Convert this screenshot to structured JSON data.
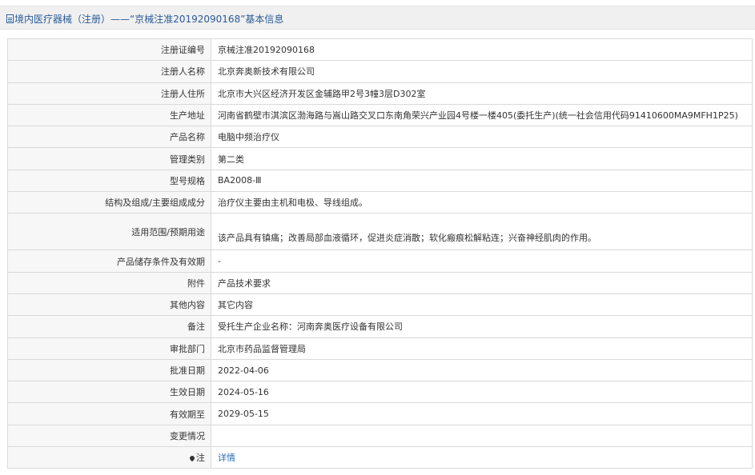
{
  "header": {
    "icon": "document-icon",
    "title": "境内医疗器械（注册）——“京械注准20192090168”基本信息"
  },
  "rows": [
    {
      "label": "注册证编号",
      "value": "京械注准20192090168"
    },
    {
      "label": "注册人名称",
      "value": "北京奔奥新技术有限公司"
    },
    {
      "label": "注册人住所",
      "value": "北京市大兴区经济开发区金辅路甲2号3幢3层D302室"
    },
    {
      "label": "生产地址",
      "value": "河南省鹤壁市淇滨区渤海路与嵩山路交叉口东南角荣兴产业园4号楼一楼405(委托生产)(统一社会信用代码91410600MA9MFH1P25)"
    },
    {
      "label": "产品名称",
      "value": "电脑中频治疗仪"
    },
    {
      "label": "管理类别",
      "value": "第二类"
    },
    {
      "label": "型号规格",
      "value": "BA2008-Ⅲ"
    },
    {
      "label": "结构及组成/主要组成成分",
      "value": "治疗仪主要由主机和电极、导线组成。"
    },
    {
      "label": "适用范围/预期用途",
      "value": "该产品具有镇痛；改善局部血液循环，促进炎症消散；软化瘢痕松解粘连；兴奋神经肌肉的作用。"
    },
    {
      "label": "产品储存条件及有效期",
      "value": "-"
    },
    {
      "label": "附件",
      "value": "产品技术要求"
    },
    {
      "label": "其他内容",
      "value": "其它内容"
    },
    {
      "label": "备注",
      "value": "受托生产企业名称：河南奔奥医疗设备有限公司"
    },
    {
      "label": "审批部门",
      "value": "北京市药品监督管理局"
    },
    {
      "label": "批准日期",
      "value": "2022-04-06"
    },
    {
      "label": "生效日期",
      "value": "2024-05-16"
    },
    {
      "label": "有效期至",
      "value": "2029-05-15"
    },
    {
      "label": "变更情况",
      "value": ""
    }
  ],
  "note_row": {
    "icon": "pin-icon",
    "label": "注",
    "link_text": "详情"
  }
}
